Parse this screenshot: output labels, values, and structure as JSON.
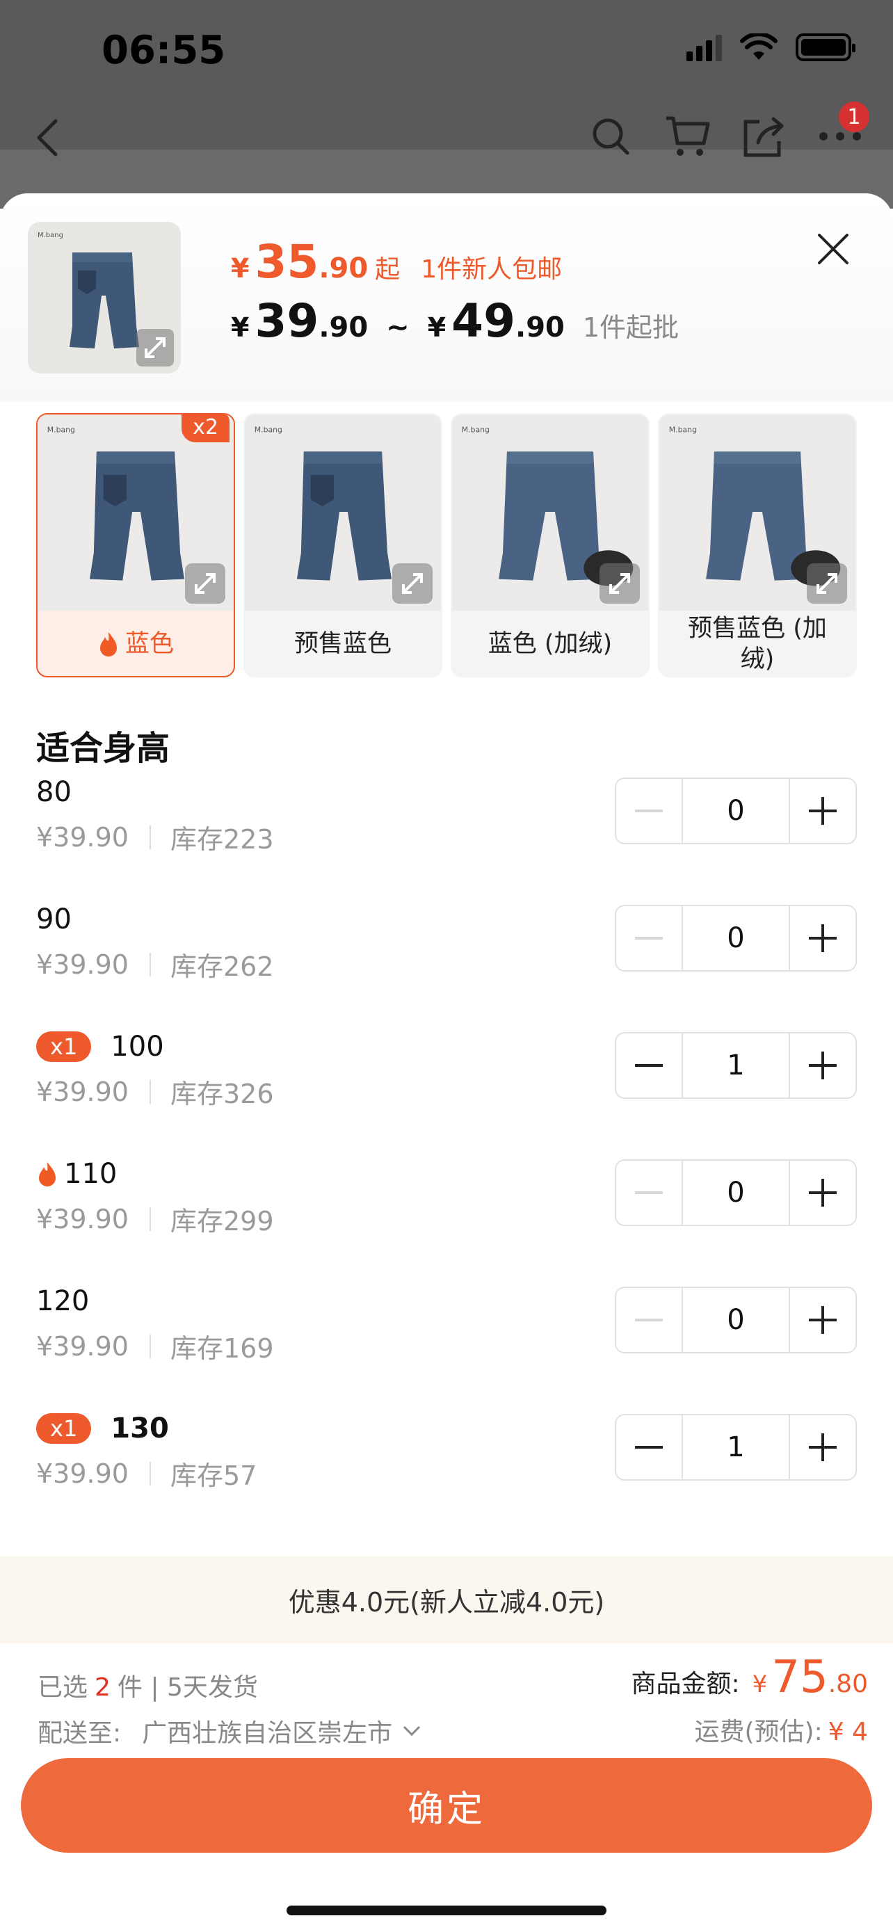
{
  "status": {
    "time": "06:55"
  },
  "nav": {
    "cart_badge": "1"
  },
  "product": {
    "price_now_int": "35",
    "price_now_dec": ".90",
    "price_now_suffix": "起",
    "promo": "1件新人包邮",
    "price_min_int": "39",
    "price_min_dec": ".90",
    "range_sep": "~",
    "price_max_int": "49",
    "price_max_dec": ".90",
    "min_order": "1件起批",
    "currency": "¥"
  },
  "colors": [
    {
      "name": "蓝色",
      "selected": true,
      "badge": "x2",
      "hot": true
    },
    {
      "name": "预售蓝色",
      "selected": false
    },
    {
      "name": "蓝色 (加绒)",
      "selected": false
    },
    {
      "name": "预售蓝色 (加绒)",
      "selected": false
    }
  ],
  "sizes_title": "适合身高",
  "sizes": [
    {
      "size": "80",
      "price": "¥39.90",
      "stock": "库存223",
      "qty": "0"
    },
    {
      "size": "90",
      "price": "¥39.90",
      "stock": "库存262",
      "qty": "0"
    },
    {
      "size": "100",
      "price": "¥39.90",
      "stock": "库存326",
      "qty": "1",
      "badge": "x1"
    },
    {
      "size": "110",
      "price": "¥39.90",
      "stock": "库存299",
      "qty": "0",
      "hot": true
    },
    {
      "size": "120",
      "price": "¥39.90",
      "stock": "库存169",
      "qty": "0"
    },
    {
      "size": "130",
      "price": "¥39.90",
      "stock": "库存57",
      "qty": "1",
      "badge": "x1"
    }
  ],
  "discount": "优惠4.0元(新人立减4.0元)",
  "footer": {
    "selected_prefix": "已选",
    "selected_count": "2",
    "selected_suffix": "件 | 5天发货",
    "ship_label": "配送至:",
    "ship_address": "广西壮族自治区崇左市",
    "amount_label": "商品金额:",
    "amount_int": "75",
    "amount_dec": ".80",
    "freight_label": "运费(预估):",
    "freight_value": "¥ 4"
  },
  "confirm_label": "确定",
  "theme": {
    "accent": "#ee5a2c",
    "button": "#ee6a3d"
  }
}
